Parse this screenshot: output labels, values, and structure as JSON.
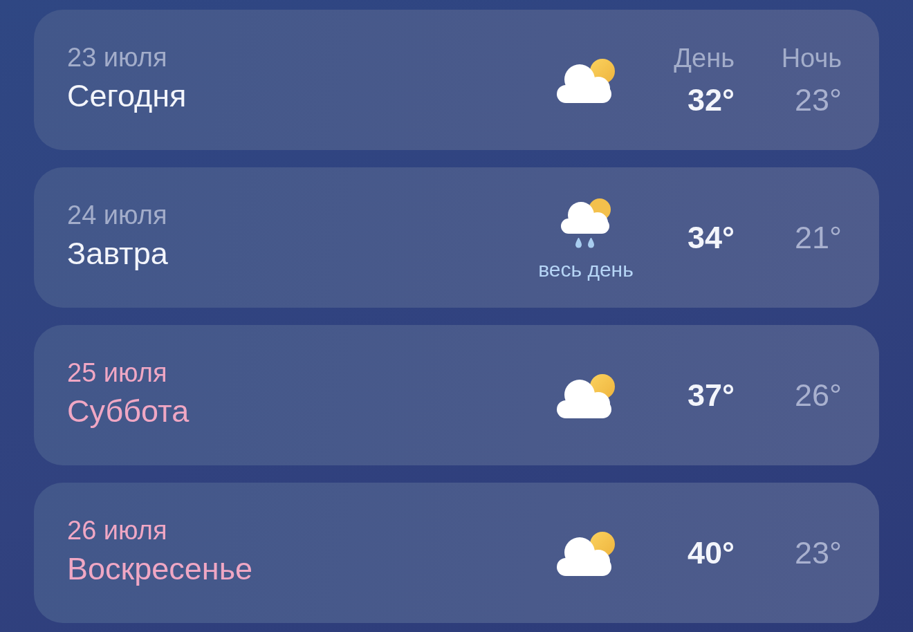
{
  "days": [
    {
      "date": "23 июля",
      "name": "Сегодня",
      "weekend": false,
      "kind": "partly_cloudy",
      "day_label": "День",
      "night_label": "Ночь",
      "day_temp": "32°",
      "night_temp": "23°"
    },
    {
      "date": "24 июля",
      "name": "Завтра",
      "weekend": false,
      "kind": "partly_cloudy_rain",
      "precip_note": "весь день",
      "day_temp": "34°",
      "night_temp": "21°"
    },
    {
      "date": "25 июля",
      "name": "Суббота",
      "weekend": true,
      "kind": "partly_cloudy",
      "day_temp": "37°",
      "night_temp": "26°"
    },
    {
      "date": "26 июля",
      "name": "Воскресенье",
      "weekend": true,
      "kind": "partly_cloudy",
      "day_temp": "40°",
      "night_temp": "23°"
    }
  ]
}
